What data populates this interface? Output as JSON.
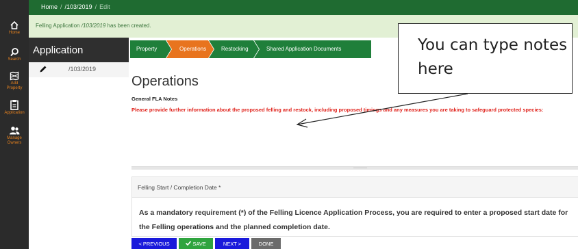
{
  "breadcrumb": {
    "home": "Home",
    "ref": "/103/2019",
    "current": "Edit"
  },
  "sidebar": {
    "items": [
      {
        "label": "Home",
        "icon": "home-icon"
      },
      {
        "label": "Search",
        "icon": "search-icon"
      },
      {
        "label": "Add Property",
        "icon": "map-icon"
      },
      {
        "label": "Application",
        "icon": "clipboard-icon"
      },
      {
        "label": "Manage Owners",
        "icon": "users-icon"
      }
    ]
  },
  "alert": {
    "prefix": "Felling Application ",
    "ref": "/103/2019",
    "suffix": " has been created."
  },
  "application": {
    "title": "Application",
    "ref": "/103/2019"
  },
  "tabs": [
    {
      "label": "Property",
      "color": "#1f7f3a"
    },
    {
      "label": "Operations",
      "color": "#e8741e"
    },
    {
      "label": "Restocking",
      "color": "#1f7f3a"
    },
    {
      "label": "Shared Application Documents",
      "color": "#1f7f3a"
    }
  ],
  "page": {
    "title": "Operations",
    "notes_label": "General FLA Notes",
    "notes_prompt": "Please provide further information about the proposed felling and restock, including proposed timings and any measures you are taking to safeguard protected species:",
    "notes_value": ""
  },
  "felling_panel": {
    "title": "Felling Start / Completion Date *",
    "body": "As a mandatory requirement (*) of the Felling Licence Application Process, you are required to enter a proposed start date for the Felling operations and the planned completion date."
  },
  "buttons": {
    "previous": "< PREVIOUS",
    "save": "SAVE",
    "next": "NEXT >",
    "done": "DONE"
  },
  "annotation": {
    "text": "You can type notes here"
  },
  "colors": {
    "rail": "#2b2b2b",
    "topbar": "#1f6b31",
    "alert_bg": "#e2f0d4",
    "accent_orange": "#e8821e",
    "tab_active": "#e8741e",
    "tab_green": "#1f7f3a",
    "prompt_red": "#e0221b",
    "button_blue": "#1a1adb",
    "button_green": "#2fa43f",
    "button_grey": "#6b6b6b"
  }
}
